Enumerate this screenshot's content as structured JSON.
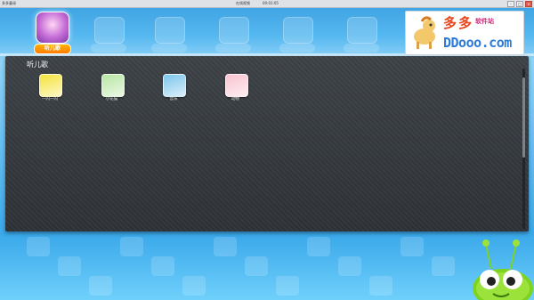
{
  "window": {
    "title": "多多童谣",
    "caption": "在线视频",
    "clock": "00:01:05"
  },
  "nav": {
    "active_label": "听儿歌",
    "items": [
      {
        "name": "nav-listen-songs",
        "icon": "cartoon-girl-icon",
        "active": true
      },
      {
        "name": "nav-item-2",
        "icon": "video-icon",
        "active": false
      },
      {
        "name": "nav-item-3",
        "icon": "book-icon",
        "active": false
      },
      {
        "name": "nav-item-4",
        "icon": "blackboard-icon",
        "active": false
      },
      {
        "name": "nav-item-5",
        "icon": "game-icon",
        "active": false
      },
      {
        "name": "nav-item-6",
        "icon": "music-icon",
        "active": false
      }
    ]
  },
  "logo": {
    "cn": "多多",
    "sub": "软件站",
    "en": "DDooo.com"
  },
  "panel": {
    "title": "听儿歌"
  },
  "grid": [
    {
      "caption": "一闪一闪",
      "color": "#f5e33a"
    },
    {
      "caption": "小花猫",
      "color": "#b8e6a3"
    },
    {
      "caption": "音乐",
      "color": "#7cc6ec"
    },
    {
      "caption": "动物",
      "color": "#f9c3d0"
    }
  ],
  "colors": {
    "accent": "#ff8a00",
    "panel_bg": "#33373c"
  }
}
